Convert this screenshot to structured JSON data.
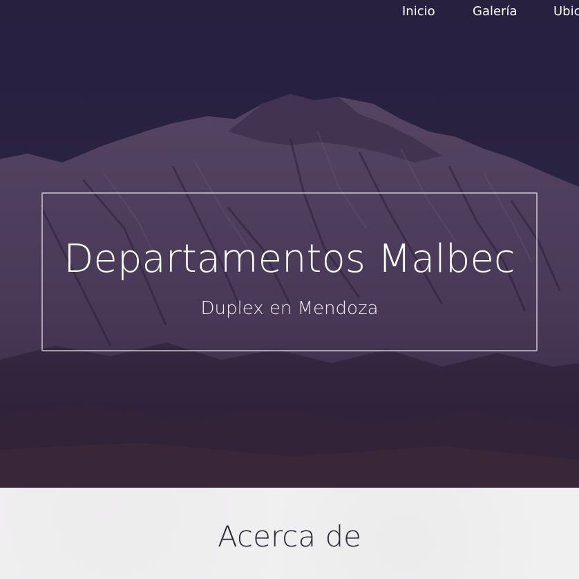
{
  "nav": {
    "items": [
      {
        "label": "Inicio"
      },
      {
        "label": "Galería"
      },
      {
        "label": "Ubic"
      }
    ]
  },
  "hero": {
    "title": "Departamentos Malbec",
    "subtitle": "Duplex en Mendoza",
    "background_image": "mountain-photo"
  },
  "about": {
    "heading": "Acerca de"
  },
  "colors": {
    "hero_tint": "#2e2540",
    "about_bg": "#f1f0f1",
    "heading_text": "#2b2a3a",
    "box_border": "#dcd2e1"
  }
}
